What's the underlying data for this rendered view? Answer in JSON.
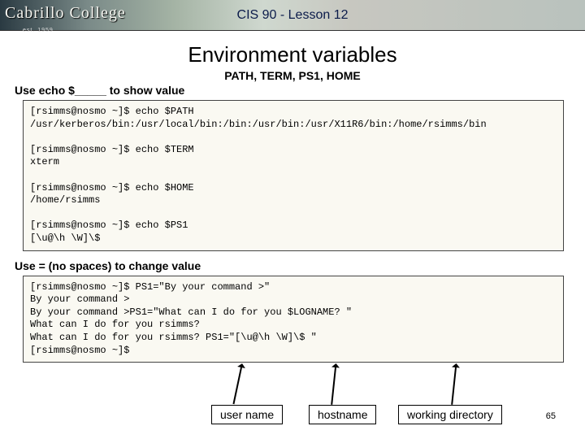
{
  "header": {
    "logo_text": "Cabrillo College",
    "logo_sub": "est. 1959",
    "title": "CIS 90 - Lesson 12"
  },
  "main_title": "Environment variables",
  "subhead": "PATH, TERM, PS1, HOME",
  "usage_show": "Use echo $_____ to show value",
  "code1": "[rsimms@nosmo ~]$ echo $PATH\n/usr/kerberos/bin:/usr/local/bin:/bin:/usr/bin:/usr/X11R6/bin:/home/rsimms/bin\n\n[rsimms@nosmo ~]$ echo $TERM\nxterm\n\n[rsimms@nosmo ~]$ echo $HOME\n/home/rsimms\n\n[rsimms@nosmo ~]$ echo $PS1\n[\\u@\\h \\W]\\$",
  "usage_change": "Use = (no spaces) to change value",
  "code2": "[rsimms@nosmo ~]$ PS1=\"By your command >\"\nBy your command >\nBy your command >PS1=\"What can I do for you $LOGNAME? \"\nWhat can I do for you rsimms?\nWhat can I do for you rsimms? PS1=\"[\\u@\\h \\W]\\$ \"\n[rsimms@nosmo ~]$",
  "callouts": {
    "user": "user name",
    "host": "hostname",
    "wd": "working directory"
  },
  "page_num": "65"
}
